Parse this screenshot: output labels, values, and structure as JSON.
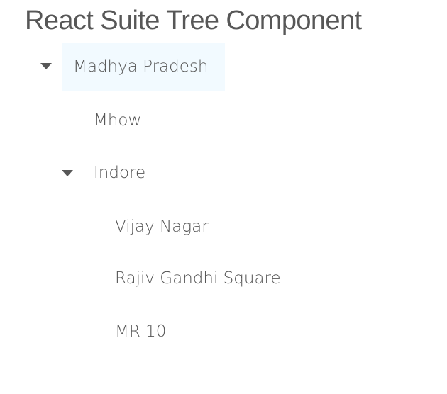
{
  "page": {
    "title": "React Suite Tree Component"
  },
  "tree": {
    "nodes": [
      {
        "label": "Madhya Pradesh",
        "level": 0,
        "expanded": true,
        "selected": true
      },
      {
        "label": "Mhow",
        "level": 1,
        "expanded": null,
        "selected": false
      },
      {
        "label": "Indore",
        "level": 1,
        "expanded": true,
        "selected": false
      },
      {
        "label": "Vijay Nagar",
        "level": 2,
        "expanded": null,
        "selected": false
      },
      {
        "label": "Rajiv Gandhi Square",
        "level": 2,
        "expanded": null,
        "selected": false
      },
      {
        "label": "MR 10",
        "level": 2,
        "expanded": null,
        "selected": false
      }
    ]
  },
  "colors": {
    "text": "#575757",
    "selected_background": "#f2faff"
  },
  "icons": {
    "expanded_caret": "caret-down-icon"
  }
}
